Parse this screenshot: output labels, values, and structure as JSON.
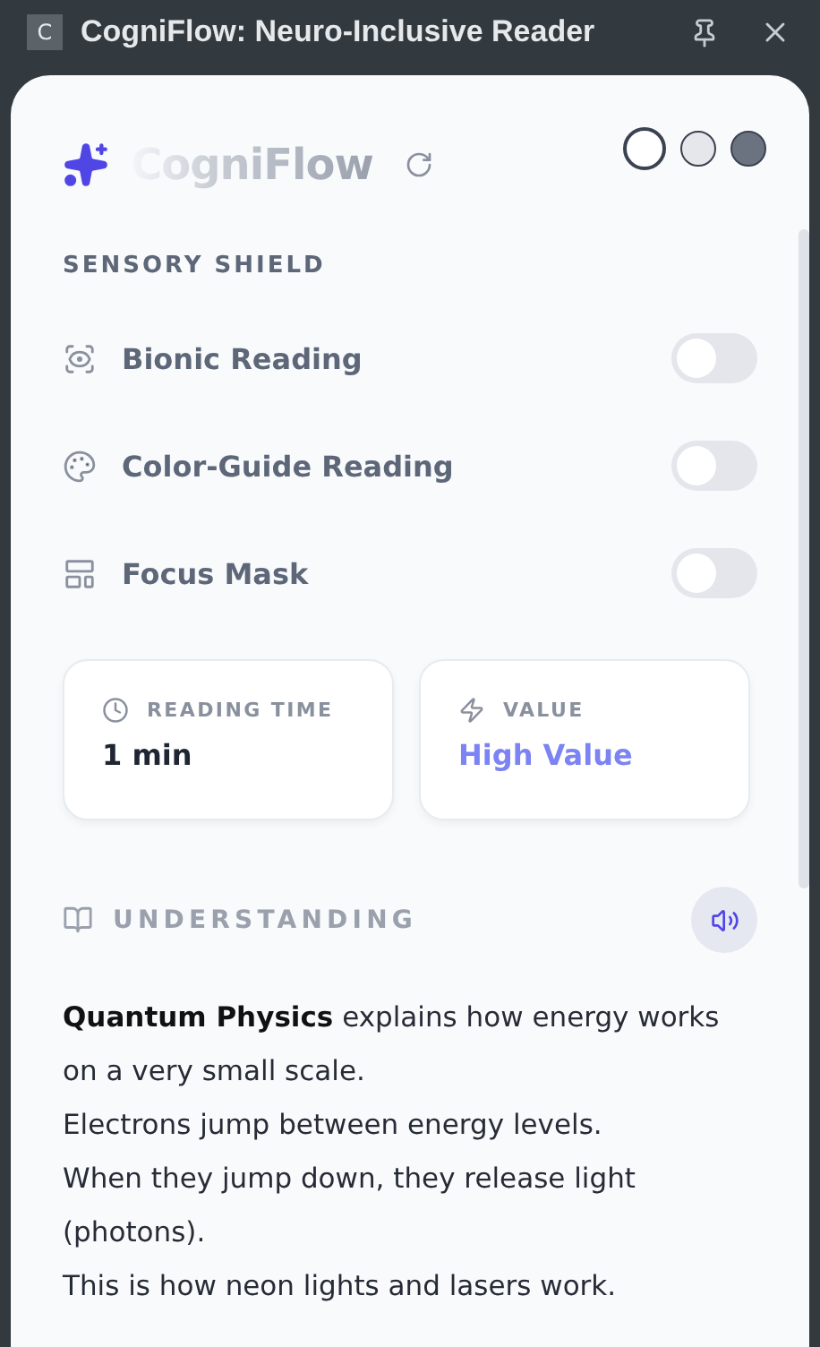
{
  "window": {
    "app_letter": "C",
    "title": "CogniFlow: Neuro-Inclusive Reader"
  },
  "header": {
    "brand": "CogniFlow",
    "themes": [
      {
        "color": "#ffffff",
        "selected": true
      },
      {
        "color": "#e5e7eb",
        "selected": false
      },
      {
        "color": "#6b7280",
        "selected": false
      }
    ]
  },
  "sensory_shield": {
    "heading": "SENSORY SHIELD",
    "toggles": [
      {
        "kind": "eye",
        "label": "Bionic Reading",
        "on": false
      },
      {
        "kind": "palette",
        "label": "Color-Guide Reading",
        "on": false
      },
      {
        "kind": "layout",
        "label": "Focus Mask",
        "on": false
      }
    ]
  },
  "stats": [
    {
      "kind": "clock",
      "label": "READING TIME",
      "value": "1 min"
    },
    {
      "kind": "bolt",
      "label": "VALUE",
      "value": "High Value"
    }
  ],
  "understanding": {
    "heading": "UNDERSTANDING",
    "lines": [
      "**Quantum Physics** explains how energy works on a very small scale.",
      "Electrons jump between energy levels.",
      "When they jump down, they release light (photons).",
      "This is how neon lights and lasers work."
    ]
  }
}
